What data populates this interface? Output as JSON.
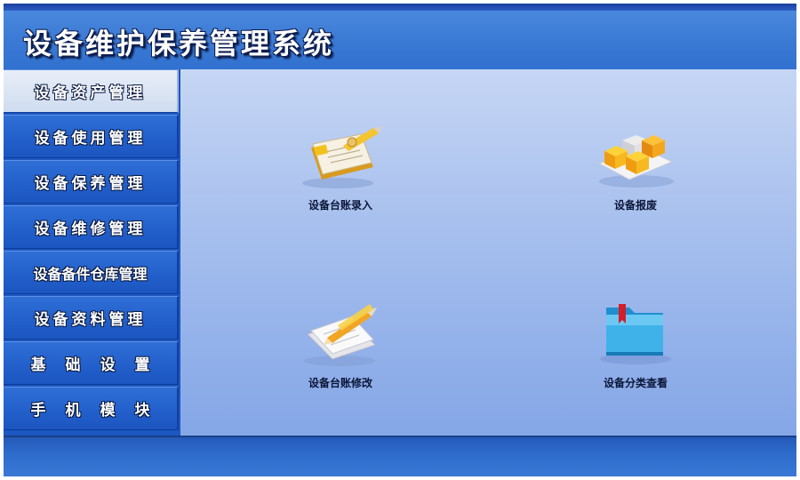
{
  "app": {
    "title": "设备维护保养管理系统"
  },
  "sidebar": {
    "items": [
      {
        "label": "设备资产管理",
        "active": true
      },
      {
        "label": "设备使用管理"
      },
      {
        "label": "设备保养管理"
      },
      {
        "label": "设备维修管理"
      },
      {
        "label": "设备备件仓库管理"
      },
      {
        "label": "设备资料管理"
      },
      {
        "label": "基础设置"
      },
      {
        "label": "手机模块"
      }
    ]
  },
  "main": {
    "tiles": [
      {
        "label": "设备台账录入",
        "icon": "ledger-entry-icon"
      },
      {
        "label": "设备报废",
        "icon": "scrap-boxes-icon"
      },
      {
        "label": "设备台账修改",
        "icon": "ledger-edit-icon"
      },
      {
        "label": "设备分类查看",
        "icon": "category-folder-icon"
      }
    ]
  },
  "colors": {
    "header": "#3a79d4",
    "sidebar_item": "#2461cc",
    "content_bg": "#a9c1ee",
    "footer": "#2e6ccc"
  }
}
